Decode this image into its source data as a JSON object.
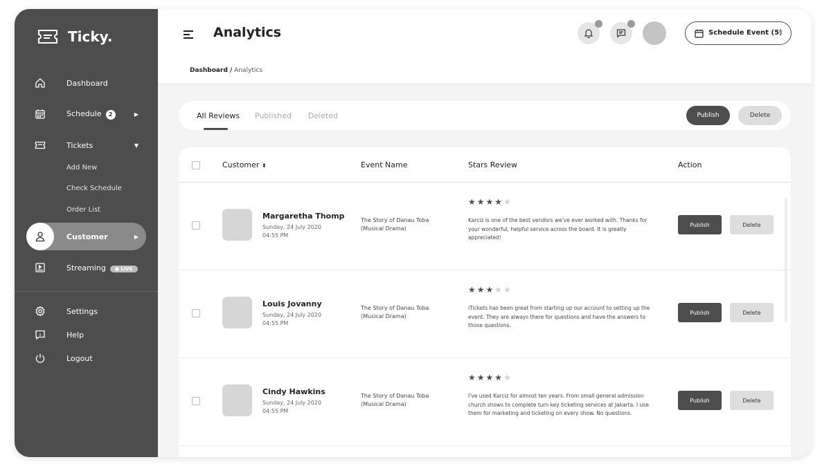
{
  "app": {
    "brand": "Ticky."
  },
  "sidebar": {
    "dashboard": "Dashboard",
    "schedule": "Schedule",
    "schedule_badge": "2",
    "tickets": "Tickets",
    "tickets_sub": [
      "Add New",
      "Check Schedule",
      "Order List"
    ],
    "customer": "Customer",
    "streaming": "Streaming",
    "live_badge": "● LIVE",
    "settings": "Settings",
    "help": "Help",
    "logout": "Logout"
  },
  "header": {
    "title": "Analytics",
    "schedule_button": "Schedule Event (5)"
  },
  "breadcrumb": {
    "root": "Dashboard /",
    "current": " Analytics"
  },
  "tabs": {
    "all_reviews": "All Reviews",
    "published": "Published",
    "deleted": "Deleted",
    "publish": "Publish",
    "delete": "Delete"
  },
  "table": {
    "headers": {
      "customer": "Customer",
      "event": "Event Name",
      "stars": "Stars Review",
      "action": "Action"
    },
    "rows": [
      {
        "name": "Margaretha Thomp",
        "date": "Sunday, 24 July 2020",
        "time": "04:55 PM",
        "event_line1": "The Story of Danau Toba",
        "event_line2": "(Musical Drama)",
        "rating": 4,
        "review": "Karciz is one of the best vendors we've ever worked with. Thanks for your wonderful, helpful service across the board. It is greatly appreciated!",
        "publish": "Publish",
        "delete": "Delete"
      },
      {
        "name": "Louis Jovanny",
        "date": "Sunday, 24 July 2020",
        "time": "04:55 PM",
        "event_line1": "The Story of Danau Toba",
        "event_line2": "(Musical Drama)",
        "rating": 3,
        "review": "iTickets has been great from starting up our account to setting up the event. They are always there for questions and have the answers to those questions.",
        "publish": "Publish",
        "delete": "Delete"
      },
      {
        "name": "Cindy Hawkins",
        "date": "Sunday, 24 July 2020",
        "time": "04:55 PM",
        "event_line1": "The Story of Danau Toba",
        "event_line2": "(Musical Drama)",
        "rating": 4,
        "review": "I've used Karciz for almost ten years. From small general admission church shows to complete turn key ticketing services at Jakarta. I use them for marketing and ticketing on every show. No questions.",
        "publish": "Publish",
        "delete": "Delete"
      }
    ]
  }
}
